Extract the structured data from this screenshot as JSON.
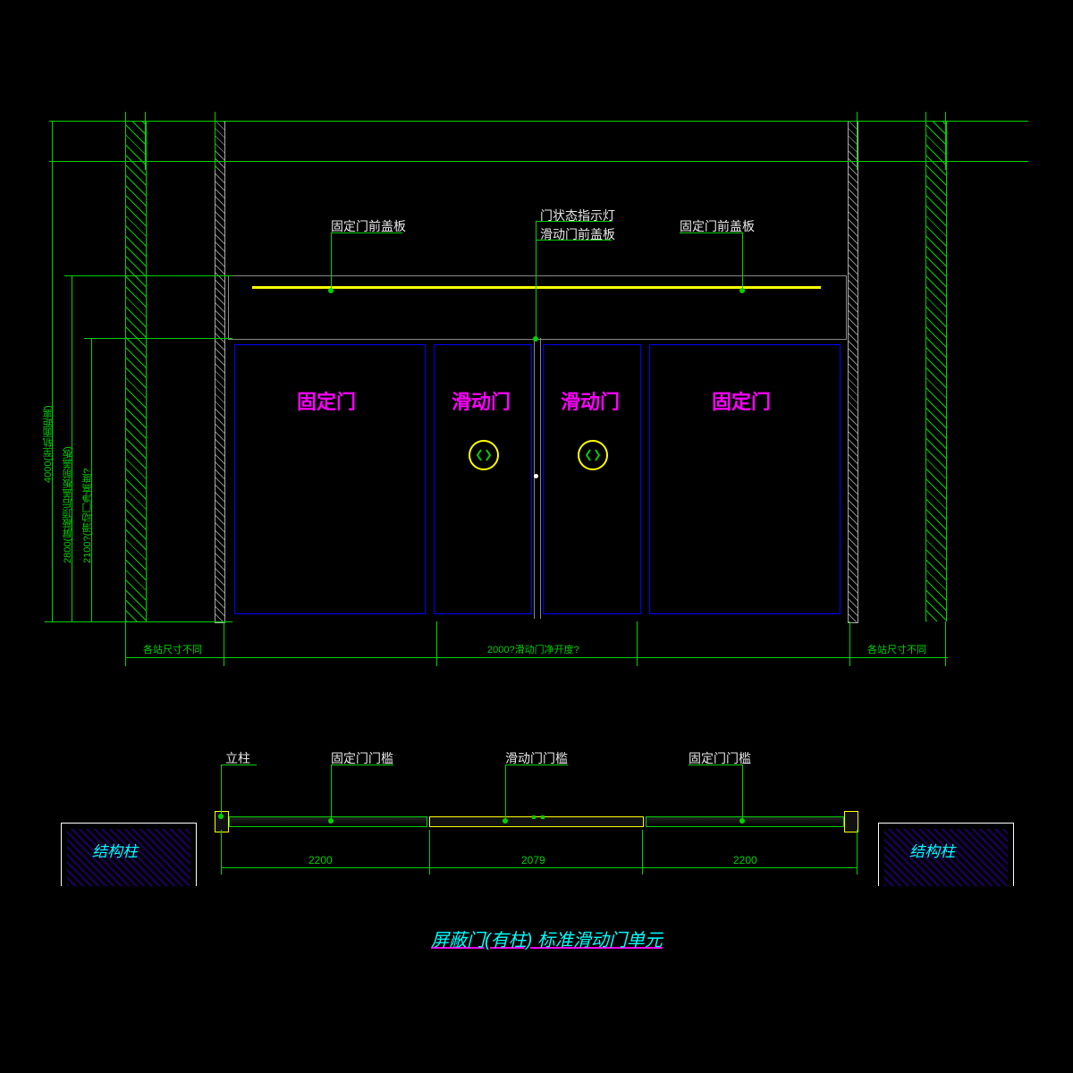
{
  "title": "屏蔽门(有柱) 标准滑动门单元",
  "elevation": {
    "labels": {
      "fixed_cover_left": "固定门前盖板",
      "status_light": "门状态指示灯",
      "sliding_cover": "滑动门前盖板",
      "fixed_cover_right": "固定门前盖板"
    },
    "doors": {
      "fixed_left": "固定门",
      "sliding_left": "滑动门",
      "sliding_right": "滑动门",
      "fixed_right": "固定门"
    },
    "dims_v": {
      "h1": "4000(至轨面距离)",
      "h2": "2800(屏蔽顶后盖板前盖板)",
      "h3": "2100?(滑动门净高度?"
    },
    "dims_h": {
      "left_note": "各站尺寸不同",
      "mid_note": "2000?滑动门净开度?",
      "right_note": "各站尺寸不同"
    }
  },
  "plan": {
    "labels": {
      "column": "立柱",
      "fixed_sill_l": "固定门门槛",
      "sliding_sill": "滑动门门槛",
      "fixed_sill_r": "固定门门槛",
      "struct_col": "结构柱"
    },
    "dims": {
      "a": "2200",
      "b": "2079",
      "c": "2200"
    }
  }
}
